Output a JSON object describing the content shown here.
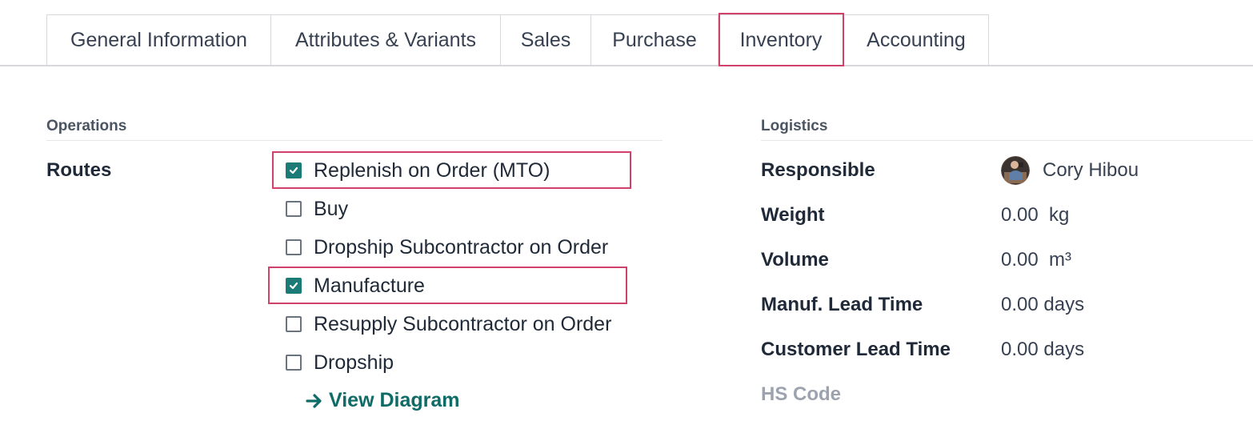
{
  "tabs": {
    "general": "General Information",
    "attributes": "Attributes & Variants",
    "sales": "Sales",
    "purchase": "Purchase",
    "inventory": "Inventory",
    "accounting": "Accounting",
    "active": "Inventory"
  },
  "operations": {
    "title": "Operations",
    "routes_label": "Routes",
    "routes": [
      {
        "label": "Replenish on Order (MTO)",
        "checked": true
      },
      {
        "label": "Buy",
        "checked": false
      },
      {
        "label": "Dropship Subcontractor on Order",
        "checked": false
      },
      {
        "label": "Manufacture",
        "checked": true
      },
      {
        "label": "Resupply Subcontractor on Order",
        "checked": false
      },
      {
        "label": "Dropship",
        "checked": false
      }
    ],
    "view_diagram": "View Diagram"
  },
  "logistics": {
    "title": "Logistics",
    "responsible_label": "Responsible",
    "responsible_value": "Cory Hibou",
    "weight_label": "Weight",
    "weight_value": "0.00",
    "weight_unit": "kg",
    "volume_label": "Volume",
    "volume_value": "0.00",
    "volume_unit": "m³",
    "manuf_lead_label": "Manuf. Lead Time",
    "manuf_lead_value": "0.00 days",
    "customer_lead_label": "Customer Lead Time",
    "customer_lead_value": "0.00 days",
    "hs_code_label": "HS Code"
  },
  "colors": {
    "accent": "#1b7c77",
    "highlight": "#d1426b",
    "link": "#0f6b66"
  },
  "icons": {
    "checkbox_check": "check-icon",
    "arrow": "arrow-right-icon",
    "avatar": "user-avatar"
  }
}
